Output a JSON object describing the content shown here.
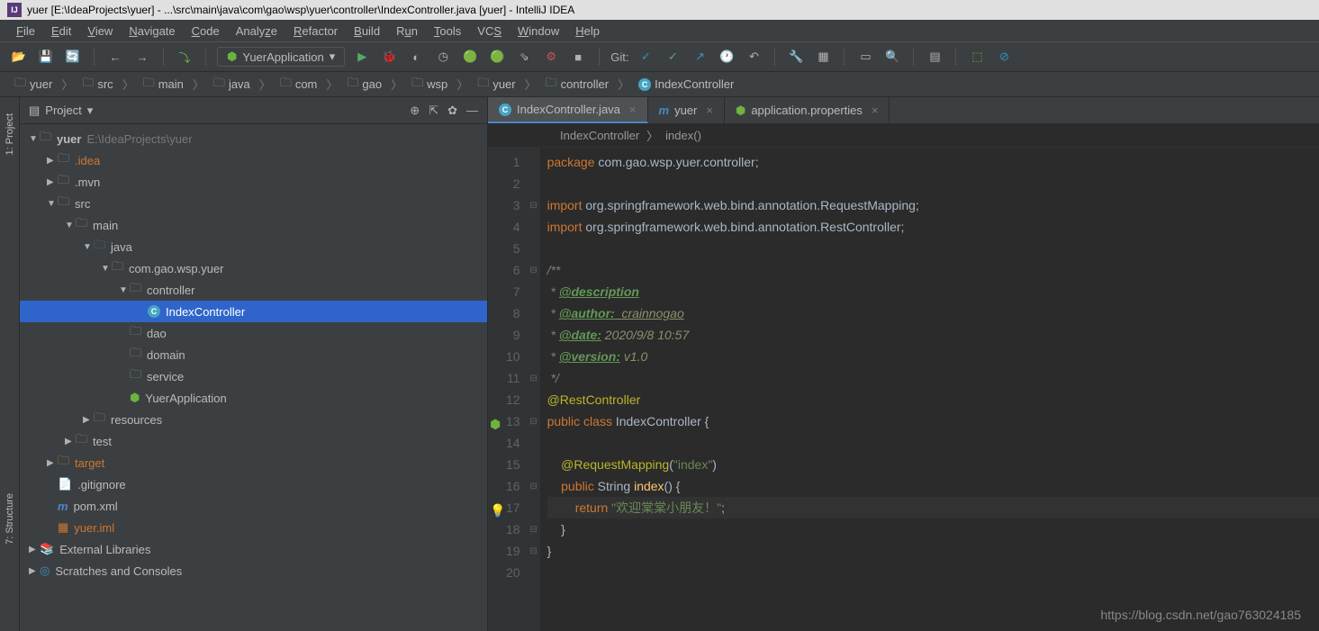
{
  "window": {
    "title": "yuer [E:\\IdeaProjects\\yuer] - ...\\src\\main\\java\\com\\gao\\wsp\\yuer\\controller\\IndexController.java [yuer] - IntelliJ IDEA"
  },
  "menu": {
    "items": [
      "File",
      "Edit",
      "View",
      "Navigate",
      "Code",
      "Analyze",
      "Refactor",
      "Build",
      "Run",
      "Tools",
      "VCS",
      "Window",
      "Help"
    ]
  },
  "toolbar": {
    "run_config": "YuerApplication",
    "git_label": "Git:"
  },
  "breadcrumb": {
    "items": [
      "yuer",
      "src",
      "main",
      "java",
      "com",
      "gao",
      "wsp",
      "yuer",
      "controller",
      "IndexController"
    ]
  },
  "project_panel": {
    "title": "Project",
    "root": {
      "name": "yuer",
      "path": "E:\\IdeaProjects\\yuer"
    },
    "nodes": {
      "idea": ".idea",
      "mvn": ".mvn",
      "src": "src",
      "main": "main",
      "java": "java",
      "pkg": "com.gao.wsp.yuer",
      "controller": "controller",
      "index_controller": "IndexController",
      "dao": "dao",
      "domain": "domain",
      "service": "service",
      "yuer_app": "YuerApplication",
      "resources": "resources",
      "test": "test",
      "target": "target",
      "gitignore": ".gitignore",
      "pom": "pom.xml",
      "yuer_iml": "yuer.iml",
      "ext_lib": "External Libraries",
      "scratches": "Scratches and Consoles"
    }
  },
  "side_tabs": {
    "project": "1: Project",
    "structure": "7: Structure"
  },
  "editor": {
    "tabs": [
      {
        "label": "IndexController.java",
        "icon": "class"
      },
      {
        "label": "yuer",
        "icon": "maven"
      },
      {
        "label": "application.properties",
        "icon": "props"
      }
    ],
    "breadcrumb": [
      "IndexController",
      "index()"
    ],
    "code": {
      "l1_kw": "package",
      "l1_rest": " com.gao.wsp.yuer.controller;",
      "l3_kw": "import",
      "l3_rest": " org.springframework.web.bind.annotation.RequestMapping;",
      "l4_kw": "import",
      "l4_rest": " org.springframework.web.bind.annotation.RestController;",
      "l6": "/**",
      "l7_pre": " * ",
      "l7_tag": "@description",
      "l8_pre": " * ",
      "l8_tag": "@author:",
      "l8_val": "  crainnogao",
      "l9_pre": " * ",
      "l9_tag": "@date:",
      "l9_val": " 2020/9/8 10:57",
      "l10_pre": " * ",
      "l10_tag": "@version:",
      "l10_val": " v1.0",
      "l11": " */",
      "l12": "@RestController",
      "l13_pub": "public ",
      "l13_cls": "class ",
      "l13_name": "IndexController {",
      "l15_pre": "    ",
      "l15_anno": "@RequestMapping",
      "l15_paren_o": "(",
      "l15_str": "\"index\"",
      "l15_paren_c": ")",
      "l16_pre": "    ",
      "l16_pub": "public ",
      "l16_type": "String ",
      "l16_name": "index",
      "l16_rest": "() {",
      "l17_pre": "        ",
      "l17_ret": "return ",
      "l17_str": "\"欢迎棠棠小朋友！\"",
      "l17_semi": ";",
      "l18": "    }",
      "l19": "}"
    }
  },
  "watermark": "https://blog.csdn.net/gao763024185"
}
